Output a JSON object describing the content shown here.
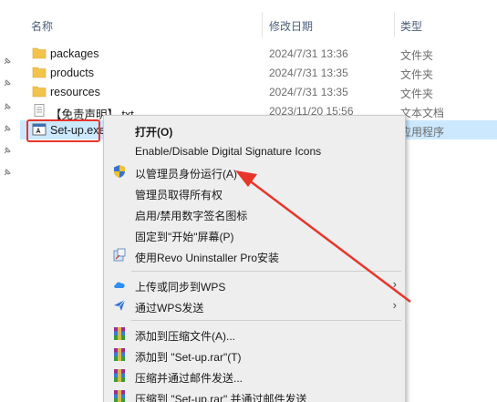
{
  "header": {
    "name_col": "名称",
    "date_col": "修改日期",
    "type_col": "类型"
  },
  "files": [
    {
      "name": "packages",
      "date": "2024/7/31 13:36",
      "type": "文件夹",
      "icon": "folder-icon"
    },
    {
      "name": "products",
      "date": "2024/7/31 13:35",
      "type": "文件夹",
      "icon": "folder-icon"
    },
    {
      "name": "resources",
      "date": "2024/7/31 13:35",
      "type": "文件夹",
      "icon": "folder-icon"
    },
    {
      "name": "【免责声明】.txt",
      "date": "2023/11/20 15:56",
      "type": "文本文档",
      "icon": "text-file-icon"
    },
    {
      "name": "Set-up.exe",
      "date": "",
      "type": "应用程序",
      "icon": "application-icon"
    }
  ],
  "menu": {
    "open": "打开(O)",
    "signature": "Enable/Disable Digital Signature Icons",
    "run_as_admin": "以管理员身份运行(A)",
    "take_ownership": "管理员取得所有权",
    "toggle_signature_cn": "启用/禁用数字签名图标",
    "pin_start": "固定到\"开始\"屏幕(P)",
    "revo": "使用Revo Uninstaller Pro安装",
    "wps_upload": "上传或同步到WPS",
    "wps_send": "通过WPS发送",
    "add_archive": "添加到压缩文件(A)...",
    "add_rar": "添加到 \"Set-up.rar\"(T)",
    "compress_email": "压缩并通过邮件发送...",
    "compress_rar_email": "压缩到 \"Set-up.rar\" 并通过邮件发送"
  },
  "colors": {
    "accent_red": "#e8352a",
    "selection": "#cce8ff",
    "menu_bg": "#eeeeee"
  }
}
